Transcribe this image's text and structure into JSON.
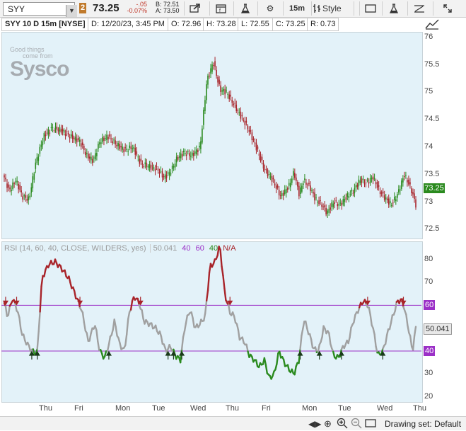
{
  "toolbar": {
    "symbol": "SYY",
    "badge": "2",
    "last": "73.25",
    "change": "-.05",
    "change_pct": "-0.07%",
    "bid": "B: 72.51",
    "ask": "A: 73.50",
    "interval": "15m",
    "style": "Style"
  },
  "header": {
    "symbol": "SYY 10 D 15m [NYSE]",
    "date": "D: 12/20/23, 3:45 PM",
    "open": "O: 72.96",
    "high": "H: 73.28",
    "low": "L: 72.55",
    "close": "C: 73.25",
    "range": "R: 0.73"
  },
  "watermark": {
    "line1": "Good things",
    "line2": "come from",
    "brand": "Sysco"
  },
  "price_axis": {
    "ticks": [
      "76",
      "75.5",
      "75",
      "74.5",
      "74",
      "73.5",
      "73",
      "72.5"
    ],
    "last_label": "73.25"
  },
  "rsi": {
    "label": "RSI (14, 60, 40, CLOSE, WILDERS, yes)",
    "value": "50.041",
    "ob1": "40",
    "ob2": "60",
    "os": "40",
    "na": "N/A",
    "ticks": [
      "80",
      "70",
      "60",
      "50",
      "40",
      "30",
      "20"
    ],
    "level_high": "60",
    "level_low": "40",
    "value_label": "50.041"
  },
  "x_axis": {
    "labels": [
      "Thu",
      "Fri",
      "Mon",
      "Tue",
      "Wed",
      "Thu",
      "Fri",
      "Mon",
      "Tue",
      "Wed",
      "Thu"
    ]
  },
  "status": {
    "drawing_set": "Drawing set: Default"
  },
  "chart_data": {
    "type": "line",
    "price_ylim": [
      72.35,
      76.1
    ],
    "rsi_ylim": [
      18,
      88
    ],
    "colors": {
      "up": "#2a8a1e",
      "down": "#a8242a",
      "neutral": "#a0a0a0",
      "level": "#9b30c7"
    },
    "price_anchors": [
      [
        0,
        73.45
      ],
      [
        6,
        73.2
      ],
      [
        14,
        73.4
      ],
      [
        22,
        73.1
      ],
      [
        30,
        73.05
      ],
      [
        38,
        73.7
      ],
      [
        48,
        74.2
      ],
      [
        58,
        74.35
      ],
      [
        70,
        74.3
      ],
      [
        80,
        74.2
      ],
      [
        92,
        74.1
      ],
      [
        100,
        73.85
      ],
      [
        108,
        73.75
      ],
      [
        116,
        74.1
      ],
      [
        126,
        74.2
      ],
      [
        136,
        74.05
      ],
      [
        146,
        73.95
      ],
      [
        156,
        74.0
      ],
      [
        166,
        73.7
      ],
      [
        176,
        73.65
      ],
      [
        186,
        73.6
      ],
      [
        194,
        73.45
      ],
      [
        202,
        73.55
      ],
      [
        210,
        73.8
      ],
      [
        218,
        73.9
      ],
      [
        228,
        73.85
      ],
      [
        238,
        74.0
      ],
      [
        246,
        75.2
      ],
      [
        254,
        75.55
      ],
      [
        262,
        75.05
      ],
      [
        270,
        75.0
      ],
      [
        280,
        74.75
      ],
      [
        288,
        74.55
      ],
      [
        296,
        74.35
      ],
      [
        306,
        74.0
      ],
      [
        316,
        73.6
      ],
      [
        326,
        73.4
      ],
      [
        336,
        73.1
      ],
      [
        346,
        73.3
      ],
      [
        352,
        73.55
      ],
      [
        358,
        73.15
      ],
      [
        364,
        73.4
      ],
      [
        372,
        73.25
      ],
      [
        378,
        73.05
      ],
      [
        386,
        72.95
      ],
      [
        392,
        72.8
      ],
      [
        400,
        73.0
      ],
      [
        408,
        72.95
      ],
      [
        416,
        73.1
      ],
      [
        424,
        73.2
      ],
      [
        432,
        73.4
      ],
      [
        440,
        73.35
      ],
      [
        448,
        73.45
      ],
      [
        456,
        73.2
      ],
      [
        464,
        73.05
      ],
      [
        470,
        72.95
      ],
      [
        478,
        73.15
      ],
      [
        486,
        73.5
      ],
      [
        494,
        73.25
      ],
      [
        500,
        72.95
      ]
    ],
    "rsi_anchors": [
      [
        0,
        61
      ],
      [
        4,
        55
      ],
      [
        10,
        63
      ],
      [
        16,
        58
      ],
      [
        22,
        47
      ],
      [
        28,
        43
      ],
      [
        34,
        40
      ],
      [
        40,
        39
      ],
      [
        46,
        72
      ],
      [
        54,
        78
      ],
      [
        62,
        79
      ],
      [
        70,
        76
      ],
      [
        78,
        72
      ],
      [
        86,
        65
      ],
      [
        94,
        58
      ],
      [
        102,
        44
      ],
      [
        110,
        52
      ],
      [
        116,
        40
      ],
      [
        122,
        37
      ],
      [
        128,
        44
      ],
      [
        134,
        53
      ],
      [
        140,
        43
      ],
      [
        146,
        40
      ],
      [
        152,
        57
      ],
      [
        158,
        64
      ],
      [
        164,
        61
      ],
      [
        170,
        53
      ],
      [
        176,
        52
      ],
      [
        184,
        50
      ],
      [
        190,
        47
      ],
      [
        196,
        40
      ],
      [
        202,
        42
      ],
      [
        208,
        38
      ],
      [
        214,
        36
      ],
      [
        220,
        52
      ],
      [
        226,
        58
      ],
      [
        232,
        50
      ],
      [
        238,
        52
      ],
      [
        244,
        55
      ],
      [
        250,
        77
      ],
      [
        256,
        79
      ],
      [
        262,
        86
      ],
      [
        268,
        65
      ],
      [
        274,
        57
      ],
      [
        280,
        55
      ],
      [
        286,
        46
      ],
      [
        292,
        44
      ],
      [
        298,
        38
      ],
      [
        304,
        36
      ],
      [
        310,
        33
      ],
      [
        316,
        36
      ],
      [
        322,
        28
      ],
      [
        328,
        30
      ],
      [
        334,
        40
      ],
      [
        340,
        35
      ],
      [
        346,
        32
      ],
      [
        352,
        30
      ],
      [
        358,
        36
      ],
      [
        364,
        54
      ],
      [
        370,
        48
      ],
      [
        376,
        41
      ],
      [
        382,
        40
      ],
      [
        388,
        50
      ],
      [
        394,
        48
      ],
      [
        400,
        38
      ],
      [
        406,
        37
      ],
      [
        412,
        42
      ],
      [
        418,
        44
      ],
      [
        424,
        53
      ],
      [
        430,
        58
      ],
      [
        436,
        62
      ],
      [
        442,
        60
      ],
      [
        448,
        50
      ],
      [
        454,
        38
      ],
      [
        460,
        40
      ],
      [
        466,
        48
      ],
      [
        472,
        55
      ],
      [
        478,
        62
      ],
      [
        484,
        62
      ],
      [
        490,
        52
      ],
      [
        496,
        40
      ],
      [
        500,
        50
      ]
    ]
  }
}
